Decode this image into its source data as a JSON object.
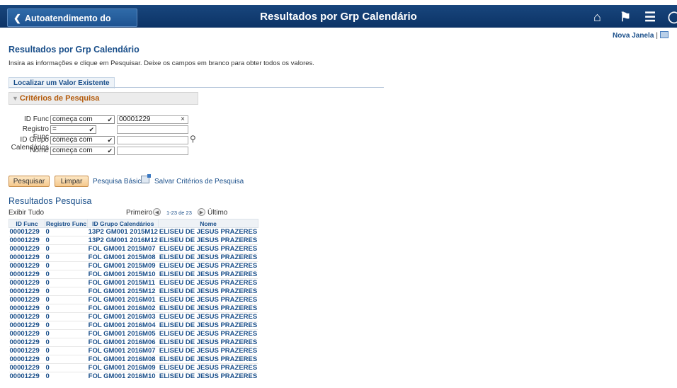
{
  "banner": {
    "back_label": "Autoatendimento do Gerente",
    "title": "Resultados por Grp Calendário",
    "icons": [
      "home-icon",
      "flag-icon",
      "menu-icon",
      "navbar-icon"
    ]
  },
  "header_links": {
    "new_window": "Nova Janela",
    "separator": "|"
  },
  "page": {
    "title": "Resultados por Grp Calendário",
    "instructions": "Insira as informações e clique em Pesquisar. Deixe os campos em branco para obter todos os valores."
  },
  "tab": {
    "label": "Localizar um Valor Existente"
  },
  "criteria": {
    "header": "Critérios de Pesquisa",
    "fields": [
      {
        "label": "ID Func",
        "operator": "começa com",
        "value": "00001229"
      },
      {
        "label": "Registro Func",
        "operator": "=",
        "value": ""
      },
      {
        "label": "ID Grupo Calendários",
        "operator": "começa com",
        "value": ""
      },
      {
        "label": "Nome",
        "operator": "começa com",
        "value": ""
      }
    ]
  },
  "actions": {
    "search": "Pesquisar",
    "clear": "Limpar",
    "basic_search": "Pesquisa Básica",
    "save_criteria": "Salvar Critérios de Pesquisa"
  },
  "results": {
    "title": "Resultados Pesquisa",
    "show_all": "Exibir Tudo",
    "first": "Primeiro",
    "count": "1-23 de 23",
    "last": "Último",
    "columns": [
      "ID Func",
      "Registro Func",
      "ID Grupo Calendários",
      "Nome"
    ],
    "rows": [
      [
        "00001229",
        "0",
        "13P2 GM001 2015M12",
        "ELISEU DE JESUS PRAZERES"
      ],
      [
        "00001229",
        "0",
        "13P2 GM001 2016M12",
        "ELISEU DE JESUS PRAZERES"
      ],
      [
        "00001229",
        "0",
        "FOL GM001 2015M07",
        "ELISEU DE JESUS PRAZERES"
      ],
      [
        "00001229",
        "0",
        "FOL GM001 2015M08",
        "ELISEU DE JESUS PRAZERES"
      ],
      [
        "00001229",
        "0",
        "FOL GM001 2015M09",
        "ELISEU DE JESUS PRAZERES"
      ],
      [
        "00001229",
        "0",
        "FOL GM001 2015M10",
        "ELISEU DE JESUS PRAZERES"
      ],
      [
        "00001229",
        "0",
        "FOL GM001 2015M11",
        "ELISEU DE JESUS PRAZERES"
      ],
      [
        "00001229",
        "0",
        "FOL GM001 2015M12",
        "ELISEU DE JESUS PRAZERES"
      ],
      [
        "00001229",
        "0",
        "FOL GM001 2016M01",
        "ELISEU DE JESUS PRAZERES"
      ],
      [
        "00001229",
        "0",
        "FOL GM001 2016M02",
        "ELISEU DE JESUS PRAZERES"
      ],
      [
        "00001229",
        "0",
        "FOL GM001 2016M03",
        "ELISEU DE JESUS PRAZERES"
      ],
      [
        "00001229",
        "0",
        "FOL GM001 2016M04",
        "ELISEU DE JESUS PRAZERES"
      ],
      [
        "00001229",
        "0",
        "FOL GM001 2016M05",
        "ELISEU DE JESUS PRAZERES"
      ],
      [
        "00001229",
        "0",
        "FOL GM001 2016M06",
        "ELISEU DE JESUS PRAZERES"
      ],
      [
        "00001229",
        "0",
        "FOL GM001 2016M07",
        "ELISEU DE JESUS PRAZERES"
      ],
      [
        "00001229",
        "0",
        "FOL GM001 2016M08",
        "ELISEU DE JESUS PRAZERES"
      ],
      [
        "00001229",
        "0",
        "FOL GM001 2016M09",
        "ELISEU DE JESUS PRAZERES"
      ],
      [
        "00001229",
        "0",
        "FOL GM001 2016M10",
        "ELISEU DE JESUS PRAZERES"
      ]
    ]
  },
  "colors": {
    "banner": "#1b4a82",
    "link": "#1a4f8a",
    "button": "#f5c98d",
    "criteria_header": "#b35a0a"
  }
}
